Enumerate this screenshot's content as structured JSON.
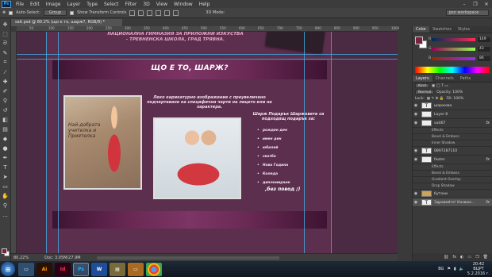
{
  "menu": {
    "logo": "Ps",
    "items": [
      "File",
      "Edit",
      "Image",
      "Layer",
      "Type",
      "Select",
      "Filter",
      "3D",
      "View",
      "Window",
      "Help"
    ],
    "window_controls": [
      "–",
      "❐",
      "✕"
    ]
  },
  "options": {
    "auto_select": "Auto-Select:",
    "auto_select_target": "Group",
    "show_transform": "Show Transform Controls",
    "mode_3d": "3D Mode:",
    "workspace": "psn workspace"
  },
  "document": {
    "tab": "sait.psd @ 80.2% (що е то, шарж?, RGB/8) *",
    "zoom": "80.22%",
    "doc_size": "Doc: 3.05M/27.9M"
  },
  "ruler": {
    "ticks": [
      "50",
      "100",
      "150",
      "200",
      "250",
      "300",
      "350",
      "400",
      "450",
      "500",
      "550",
      "600",
      "650",
      "700",
      "750",
      "800",
      "850",
      "900",
      "950",
      "1000"
    ]
  },
  "canvas": {
    "header_line1": "НАЦИОНАЛНА ГИМНАЗИЯ ЗА ПРИЛОЖНИ ИЗКУСТВА",
    "header_line2": "- ТРЕВНЕНСКА ШКОЛА, ГРАД ТРЯВНА.",
    "banner_title": "ЩО Е ТО, ШАРЖ?",
    "photo1_caption": "Най-добрата учителка и Приятелка",
    "description": "Леко карикатурно изображение с преувеличено подчертаване на специфични черти на лицето или на характера.",
    "list_heading": "Шарж Подарък Шаржовете са подходящ подарък за:",
    "list_items": [
      "рожден ден",
      "имен ден",
      "юбилей",
      "сватба",
      "Нова Година",
      "Коледа",
      "дипломиране"
    ],
    "list_footer": ",без повод ;)"
  },
  "panels": {
    "color_tabs": [
      "Color",
      "Swatches",
      "Styles"
    ],
    "color_values": {
      "r": "149",
      "g": "43",
      "b": "86"
    },
    "color_labels": {
      "r": "R",
      "g": "G",
      "b": "B"
    },
    "fg_color": "#7c2040",
    "layers_tabs": [
      "Layers",
      "Channels",
      "Paths"
    ],
    "kind": "Kind",
    "blend_mode": "Normal",
    "opacity": "Opacity: 100%",
    "lock": "Lock:",
    "fill": "Fill: 100%",
    "layers": [
      {
        "name": "шаржове",
        "type": "text"
      },
      {
        "name": "Layer 8",
        "type": "layer"
      },
      {
        "name": "vait67",
        "type": "layer",
        "fx": true
      },
      {
        "name": "Effects",
        "type": "sub"
      },
      {
        "name": "Bevel & Emboss",
        "type": "sub"
      },
      {
        "name": "Inner Shadow",
        "type": "sub"
      },
      {
        "name": "0897287110",
        "type": "text"
      },
      {
        "name": "footer",
        "type": "layer",
        "fx": true
      },
      {
        "name": "Effects",
        "type": "sub"
      },
      {
        "name": "Bevel & Emboss",
        "type": "sub"
      },
      {
        "name": "Gradient Overlay",
        "type": "sub"
      },
      {
        "name": "Drop Shadow",
        "type": "sub"
      },
      {
        "name": "бутони",
        "type": "group"
      },
      {
        "name": "Здравейте! Казвам...",
        "type": "text",
        "fx": true
      }
    ]
  },
  "taskbar": {
    "apps": [
      "",
      "Ai",
      "Id",
      "Ps",
      "W",
      "",
      "",
      ""
    ],
    "lang": "BG",
    "time": "20:42",
    "day": "ВЦРТ",
    "date": "5.2.2016 г."
  }
}
